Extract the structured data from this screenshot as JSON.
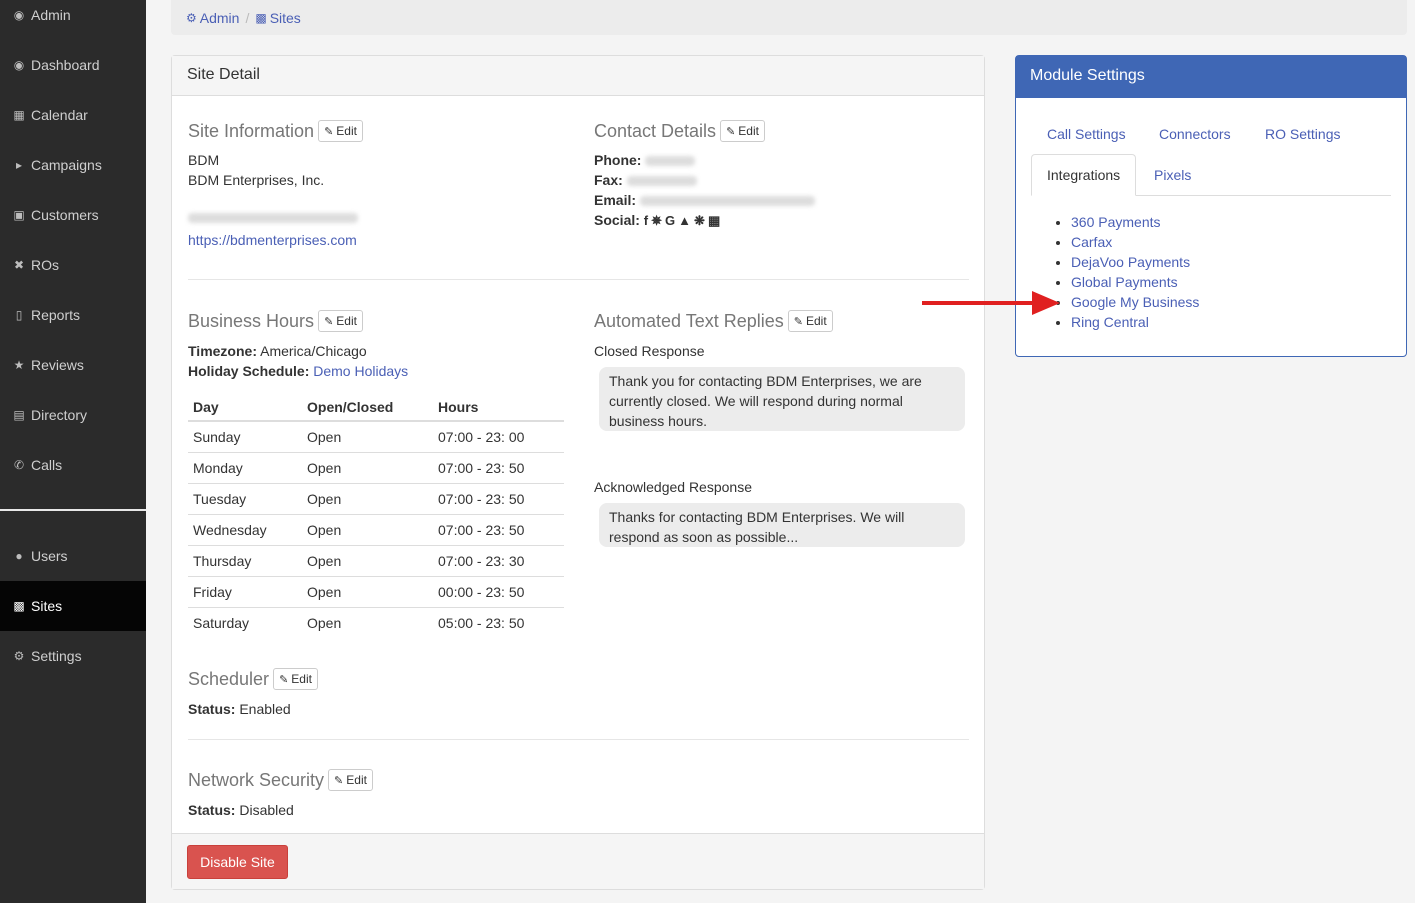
{
  "sidebar": {
    "items": [
      {
        "label": "Admin",
        "icon": "dashboard-icon"
      },
      {
        "label": "Dashboard",
        "icon": "dashboard-icon"
      },
      {
        "label": "Calendar",
        "icon": "calendar-icon"
      },
      {
        "label": "Campaigns",
        "icon": "bullhorn-icon"
      },
      {
        "label": "Customers",
        "icon": "address-book-icon"
      },
      {
        "label": "ROs",
        "icon": "wrench-icon"
      },
      {
        "label": "Reports",
        "icon": "bar-chart-icon"
      },
      {
        "label": "Reviews",
        "icon": "star-icon"
      },
      {
        "label": "Directory",
        "icon": "book-icon"
      },
      {
        "label": "Calls",
        "icon": "phone-icon"
      },
      {
        "label": "Users",
        "icon": "users-icon"
      },
      {
        "label": "Sites",
        "icon": "building-icon"
      },
      {
        "label": "Settings",
        "icon": "gear-icon"
      }
    ],
    "active": "Sites"
  },
  "breadcrumb": {
    "admin": "Admin",
    "sites": "Sites",
    "separator": "/"
  },
  "site_panel": {
    "title": "Site Detail",
    "edit_label": "Edit",
    "site_information": {
      "heading": "Site Information",
      "name": "BDM",
      "company": "BDM Enterprises, Inc.",
      "url": "https://bdmenterprises.com"
    },
    "contact_details": {
      "heading": "Contact Details",
      "phone_label": "Phone:",
      "fax_label": "Fax:",
      "email_label": "Email:",
      "social_label": "Social:"
    },
    "business_hours": {
      "heading": "Business Hours",
      "timezone_label": "Timezone:",
      "timezone": "America/Chicago",
      "holiday_label": "Holiday Schedule:",
      "holiday": "Demo Holidays",
      "columns": [
        "Day",
        "Open/Closed",
        "Hours"
      ],
      "rows": [
        [
          "Sunday",
          "Open",
          "07:00 - 23: 00"
        ],
        [
          "Monday",
          "Open",
          "07:00 - 23: 50"
        ],
        [
          "Tuesday",
          "Open",
          "07:00 - 23: 50"
        ],
        [
          "Wednesday",
          "Open",
          "07:00 - 23: 50"
        ],
        [
          "Thursday",
          "Open",
          "07:00 - 23: 30"
        ],
        [
          "Friday",
          "Open",
          "00:00 - 23: 50"
        ],
        [
          "Saturday",
          "Open",
          "05:00 - 23: 50"
        ]
      ]
    },
    "auto_replies": {
      "heading": "Automated Text Replies",
      "closed_label": "Closed Response",
      "closed_text": "Thank you for contacting BDM Enterprises, we are currently closed. We will respond during normal business hours.",
      "ack_label": "Acknowledged Response",
      "ack_text": "Thanks for contacting BDM Enterprises. We will respond as soon as possible..."
    },
    "scheduler": {
      "heading": "Scheduler",
      "status_label": "Status:",
      "status": "Enabled"
    },
    "network_security": {
      "heading": "Network Security",
      "status_label": "Status:",
      "status": "Disabled"
    },
    "disable_button": "Disable Site"
  },
  "module_settings": {
    "title": "Module Settings",
    "tabs": [
      "Call Settings",
      "Connectors",
      "RO Settings",
      "Integrations",
      "Pixels"
    ],
    "active_tab": "Integrations",
    "integrations": [
      "360 Payments",
      "Carfax",
      "DejaVoo Payments",
      "Global Payments",
      "Google My Business",
      "Ring Central"
    ]
  },
  "colors": {
    "sidebar_bg": "#2b2b2b",
    "primary": "#3f67b5",
    "danger": "#d9534f",
    "link": "#4a5fb5",
    "arrow": "#e02020"
  }
}
